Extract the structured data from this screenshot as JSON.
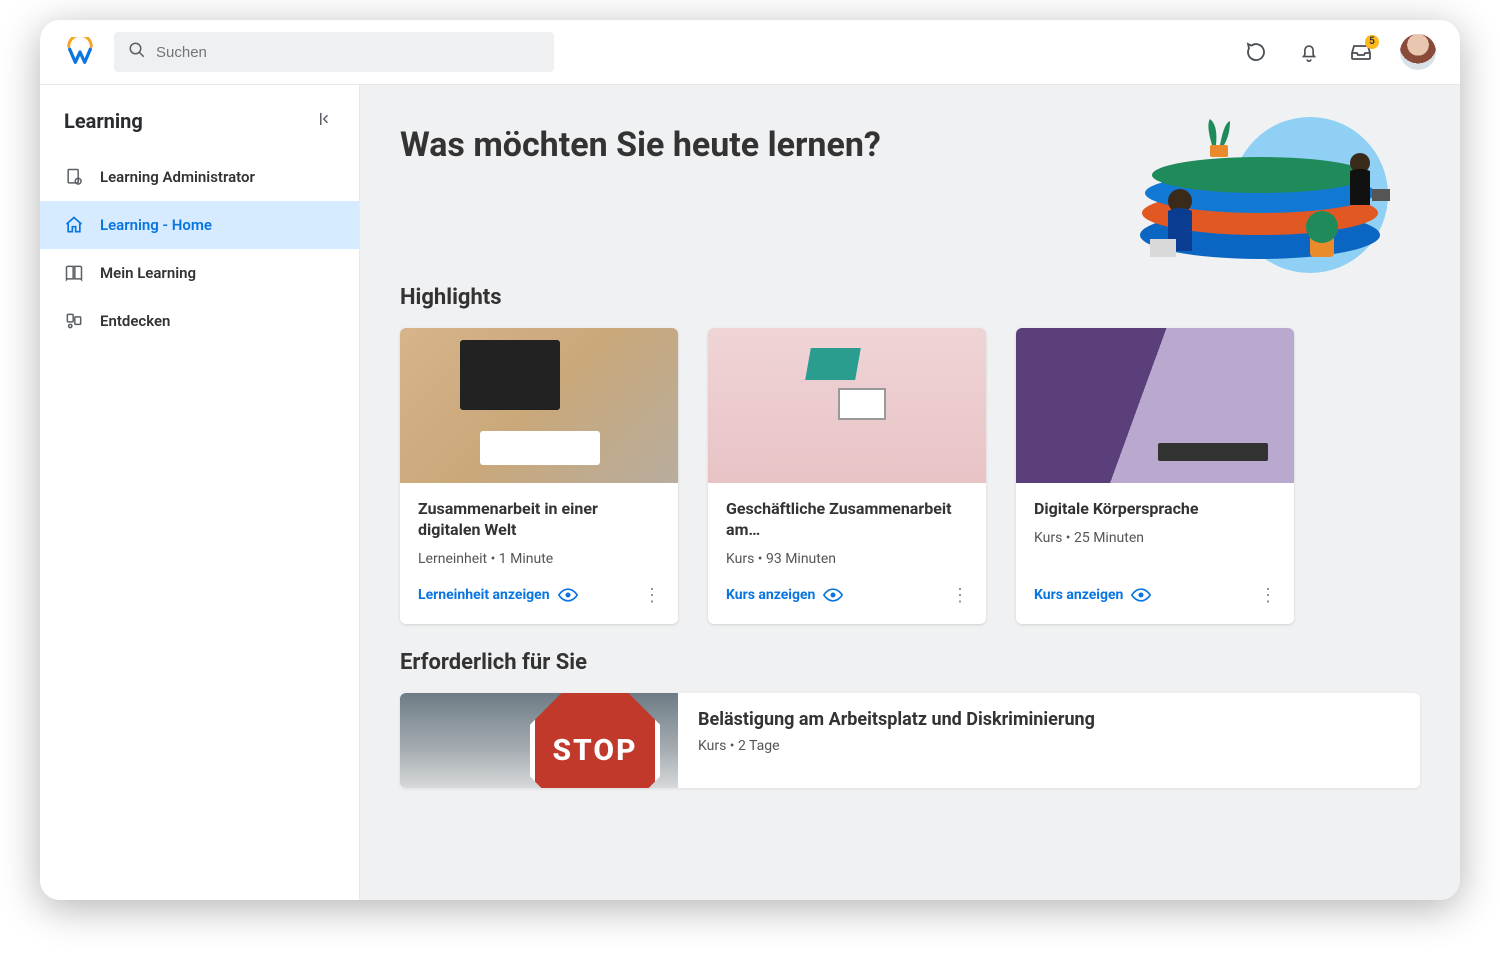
{
  "header": {
    "search_placeholder": "Suchen",
    "inbox_badge": "5"
  },
  "sidebar": {
    "title": "Learning",
    "items": [
      {
        "label": "Learning Administrator",
        "icon": "admin"
      },
      {
        "label": "Learning - Home",
        "icon": "home",
        "active": true
      },
      {
        "label": "Mein Learning",
        "icon": "book"
      },
      {
        "label": "Entdecken",
        "icon": "discover"
      }
    ]
  },
  "main": {
    "hero_title": "Was möchten Sie heute lernen?",
    "highlights": {
      "title": "Highlights",
      "cards": [
        {
          "title": "Zusammenarbeit in einer digitalen Welt",
          "meta": "Lerneinheit  •  1 Minute",
          "link": "Lerneinheit anzeigen"
        },
        {
          "title": "Geschäftliche Zusammenarbeit am…",
          "meta": "Kurs  •  93 Minuten",
          "link": "Kurs anzeigen"
        },
        {
          "title": "Digitale Körpersprache",
          "meta": "Kurs  •  25 Minuten",
          "link": "Kurs anzeigen"
        }
      ]
    },
    "required": {
      "title": "Erforderlich für Sie",
      "cards": [
        {
          "title": "Belästigung am Arbeitsplatz und Diskriminierung",
          "meta": "Kurs  •  2 Tage"
        }
      ]
    }
  }
}
